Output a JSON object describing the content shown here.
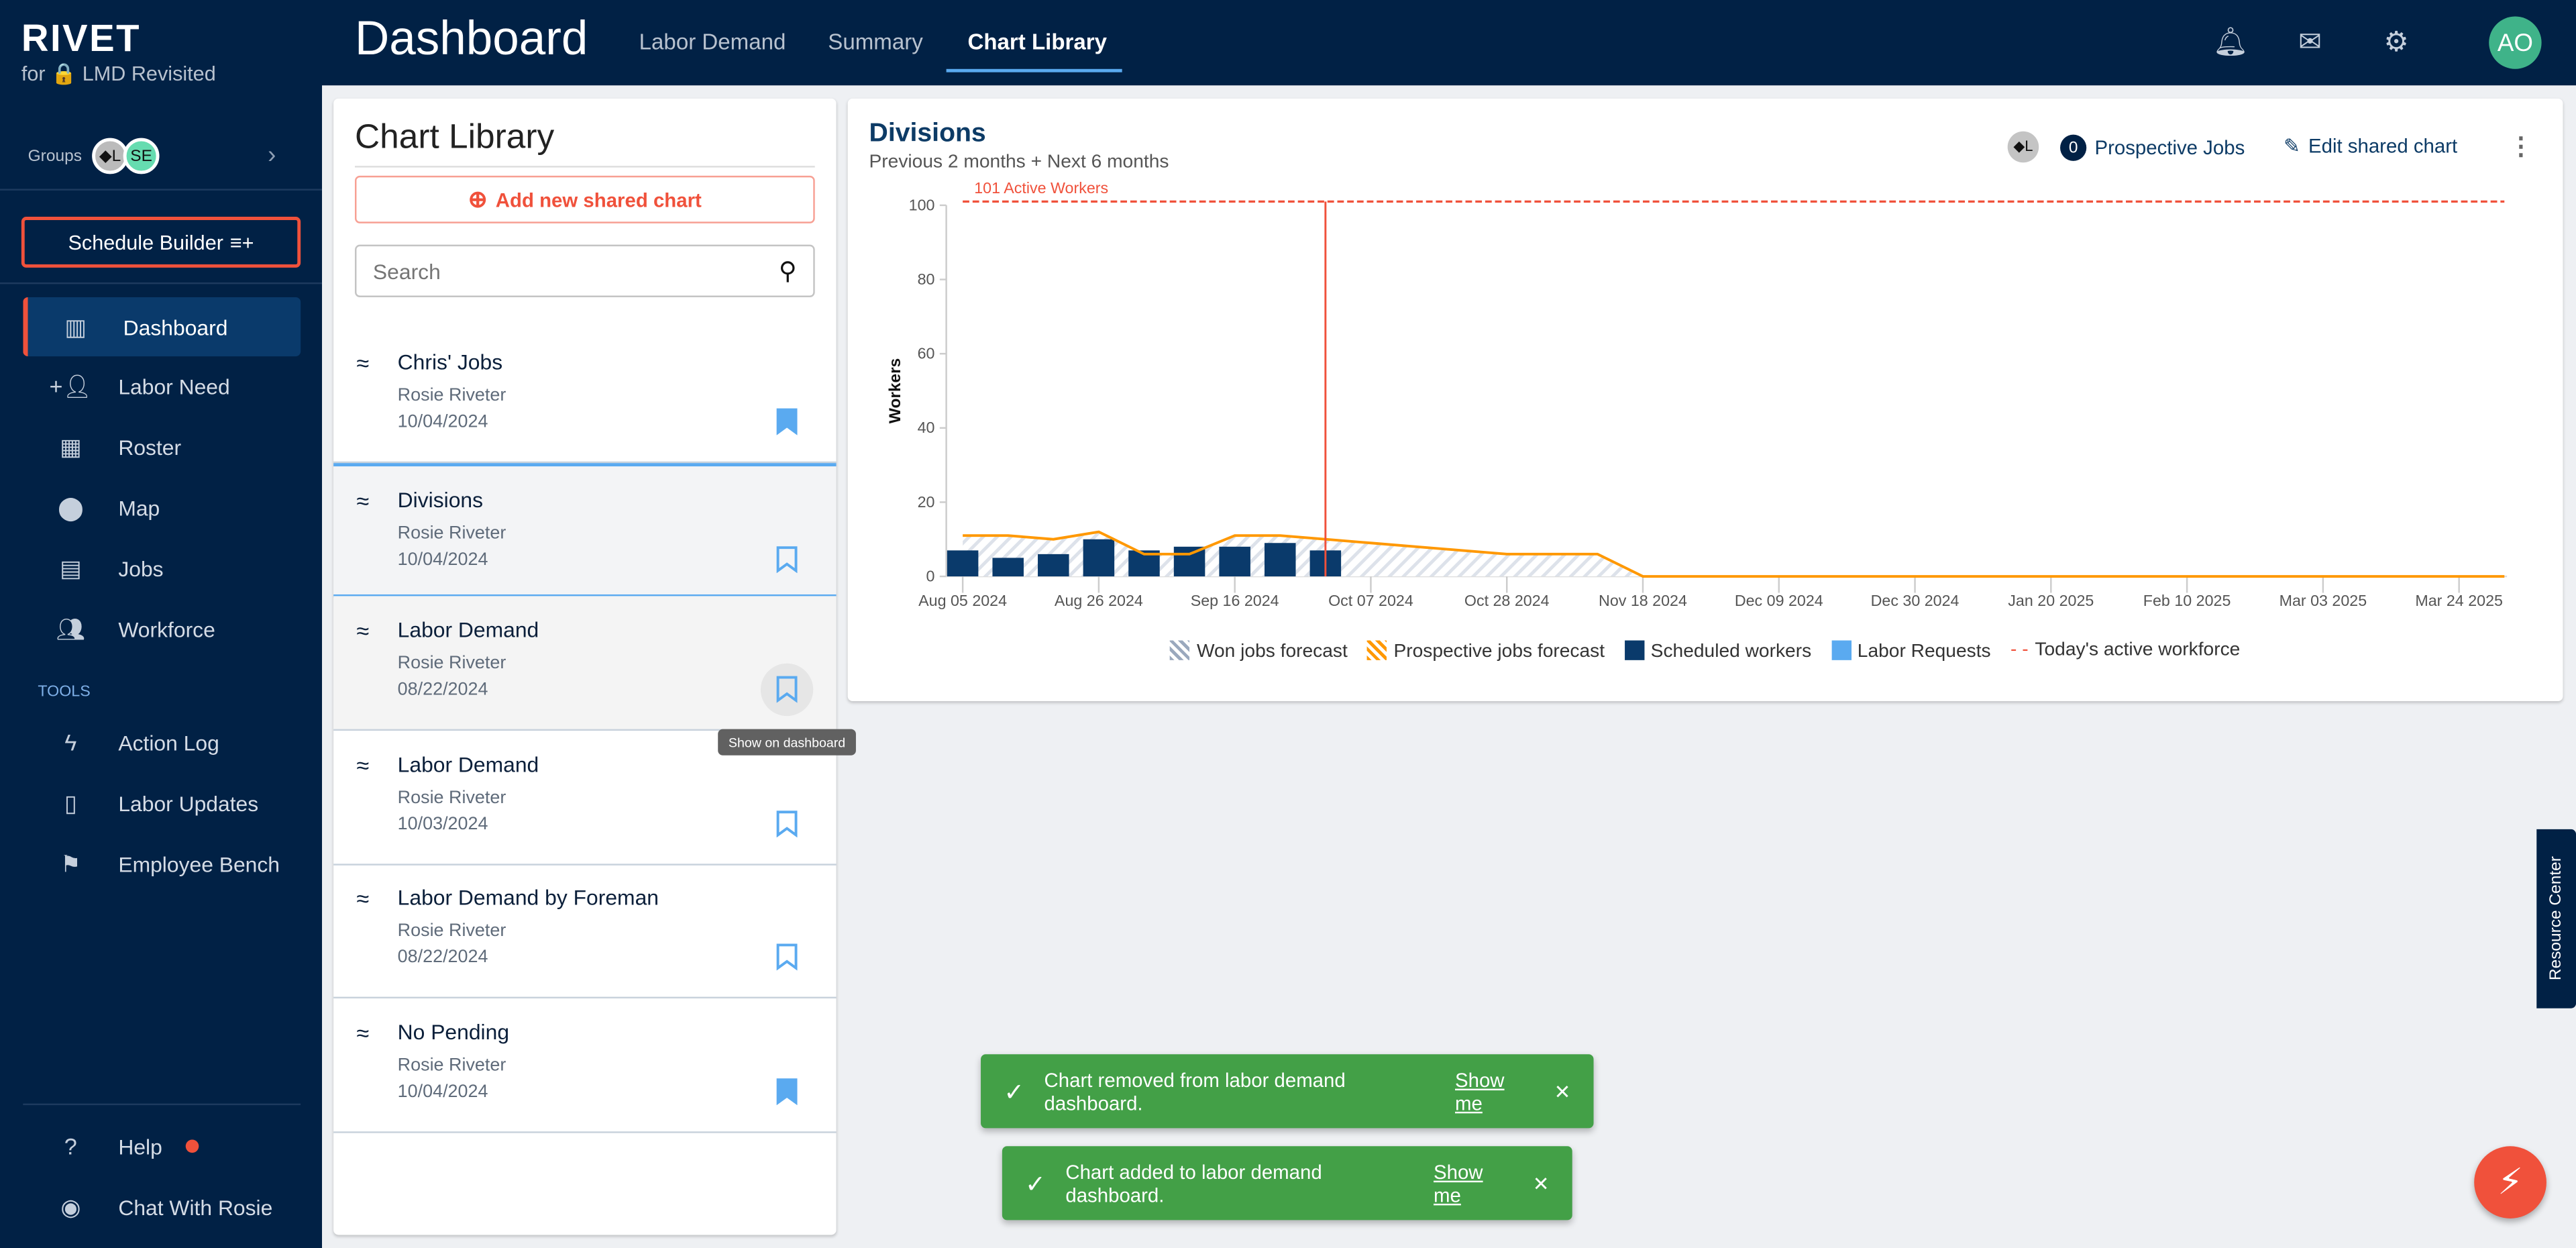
{
  "brand": {
    "name": "RIVET",
    "sub": "for 🔒 LMD Revisited"
  },
  "groups": {
    "label": "Groups",
    "chips": [
      "◆L",
      "SE"
    ]
  },
  "schedule_builder": "Schedule Builder",
  "nav": [
    {
      "label": "Dashboard",
      "icon": "bar-chart-icon"
    },
    {
      "label": "Labor Need",
      "icon": "person-add-icon"
    },
    {
      "label": "Roster",
      "icon": "table-icon"
    },
    {
      "label": "Map",
      "icon": "map-pin-icon"
    },
    {
      "label": "Jobs",
      "icon": "building-icon"
    },
    {
      "label": "Workforce",
      "icon": "people-icon"
    }
  ],
  "tools_label": "TOOLS",
  "tools": [
    {
      "label": "Action Log",
      "icon": "bolt-icon"
    },
    {
      "label": "Labor Updates",
      "icon": "radio-icon"
    },
    {
      "label": "Employee Bench",
      "icon": "flag-icon"
    }
  ],
  "bottom": [
    {
      "label": "Help",
      "icon": "help-icon"
    },
    {
      "label": "Chat With Rosie",
      "icon": "rosie-icon"
    }
  ],
  "header": {
    "title": "Dashboard",
    "tabs": [
      "Labor Demand",
      "Summary",
      "Chart Library"
    ],
    "active_tab": "Chart Library",
    "avatar": "AO"
  },
  "library": {
    "title": "Chart Library",
    "add_label": "Add new shared chart",
    "search_placeholder": "Search",
    "items": [
      {
        "name": "Chris' Jobs",
        "user": "Rosie Riveter",
        "date": "10/04/2024",
        "on_dashboard": true
      },
      {
        "name": "Divisions",
        "user": "Rosie Riveter",
        "date": "10/04/2024",
        "on_dashboard": false
      },
      {
        "name": "Labor Demand",
        "user": "Rosie Riveter",
        "date": "08/22/2024",
        "on_dashboard": false
      },
      {
        "name": "Labor Demand",
        "user": "Rosie Riveter",
        "date": "10/03/2024",
        "on_dashboard": false
      },
      {
        "name": "Labor Demand by Foreman",
        "user": "Rosie Riveter",
        "date": "08/22/2024",
        "on_dashboard": false
      },
      {
        "name": "No Pending",
        "user": "Rosie Riveter",
        "date": "10/04/2024",
        "on_dashboard": true
      }
    ],
    "tooltip": "Show on dashboard"
  },
  "chart_card": {
    "title": "Divisions",
    "subtitle": "Previous 2 months + Next 6 months",
    "group_chip": "◆L",
    "prospective_count": "0",
    "prospective_label": "Prospective Jobs",
    "edit_label": "Edit shared chart"
  },
  "chart_data": {
    "type": "bar",
    "ylabel": "Workers",
    "ylim": [
      0,
      100
    ],
    "yticks": [
      0,
      20,
      40,
      60,
      80,
      100
    ],
    "xticks": [
      "Aug 05 2024",
      "Aug 26 2024",
      "Sep 16 2024",
      "Oct 07 2024",
      "Oct 28 2024",
      "Nov 18 2024",
      "Dec 09 2024",
      "Dec 30 2024",
      "Jan 20 2025",
      "Feb 10 2025",
      "Mar 03 2025",
      "Mar 24 2025"
    ],
    "weeks": [
      "2024-08-05",
      "2024-08-12",
      "2024-08-19",
      "2024-08-26",
      "2024-09-02",
      "2024-09-09",
      "2024-09-16",
      "2024-09-23",
      "2024-09-30",
      "2024-10-07",
      "2024-10-14",
      "2024-10-21",
      "2024-10-28",
      "2024-11-04",
      "2024-11-11",
      "2024-11-18",
      "2025-03-31"
    ],
    "series": [
      {
        "name": "Scheduled workers",
        "type": "bar",
        "color": "#0a3a6b",
        "values": [
          7,
          5,
          6,
          10,
          7,
          8,
          8,
          9,
          7
        ]
      },
      {
        "name": "Prospective jobs forecast",
        "type": "line",
        "color": "#ff9800",
        "values": [
          11,
          11,
          10,
          12,
          6,
          6,
          11,
          11,
          10,
          9,
          8,
          7,
          6,
          6,
          6,
          0,
          0
        ]
      },
      {
        "name": "Won jobs forecast",
        "type": "area",
        "color": "#9aa8bd",
        "values": [
          11,
          11,
          10,
          12,
          6,
          6,
          11,
          11,
          10,
          9,
          8,
          7,
          6,
          6,
          6,
          0,
          0
        ]
      },
      {
        "name": "Labor Requests",
        "type": "bar",
        "color": "#5aaaf0",
        "values": []
      },
      {
        "name": "Today's active workforce",
        "type": "hline",
        "color": "#f0513b",
        "value": 101
      }
    ],
    "annotation": "101 Active Workers",
    "today": "2024-09-30"
  },
  "toasts": [
    {
      "text": "Chart removed from labor demand dashboard.",
      "link": "Show me"
    },
    {
      "text": "Chart added to labor demand dashboard.",
      "link": "Show me"
    }
  ],
  "resource_center": "Resource Center",
  "colors": {
    "navy": "#012145",
    "accent": "#f0513b",
    "blue": "#5aaaf0",
    "success": "#43a047"
  }
}
